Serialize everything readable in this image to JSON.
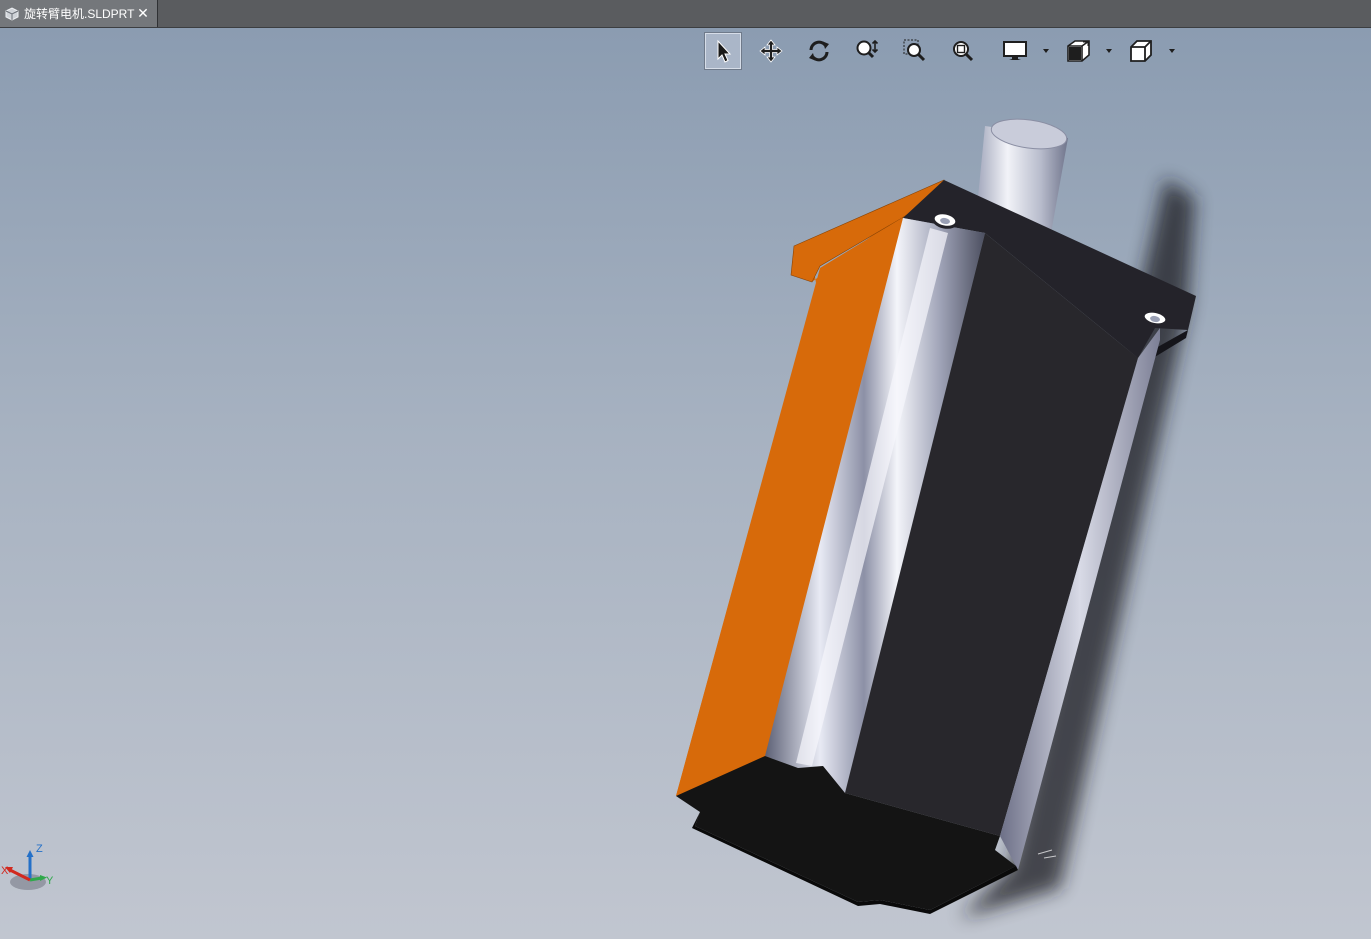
{
  "tab": {
    "title": "旋转臂电机.SLDPRT",
    "close_glyph": "✕",
    "icon": "part-file-icon"
  },
  "toolbar": {
    "tools": [
      {
        "name": "select-tool",
        "icon": "cursor-arrow-icon",
        "active": true
      },
      {
        "name": "pan-tool",
        "icon": "pan-arrows-icon",
        "active": false
      },
      {
        "name": "rotate-tool",
        "icon": "rotate-icon",
        "active": false
      },
      {
        "name": "zoom-in-out-tool",
        "icon": "zoom-in-out-icon",
        "active": false
      },
      {
        "name": "zoom-to-area-tool",
        "icon": "zoom-area-icon",
        "active": false
      },
      {
        "name": "zoom-to-fit-tool",
        "icon": "zoom-fit-icon",
        "active": false
      },
      {
        "name": "display-style-tool",
        "icon": "monitor-icon",
        "has_dropdown": true
      },
      {
        "name": "section-view-tool",
        "icon": "section-view-icon",
        "has_dropdown": true
      },
      {
        "name": "view-orientation-tool",
        "icon": "cube-view-icon",
        "has_dropdown": true
      }
    ]
  },
  "triad": {
    "x_label": "X",
    "y_label": "Y",
    "z_label": "Z"
  },
  "colors": {
    "orange_face": "#d76a0a",
    "dark_face": "#27262a",
    "bottom_face": "#141414",
    "accent_x": "#d2291f",
    "accent_y": "#2fa84a",
    "accent_z": "#2470c8"
  }
}
